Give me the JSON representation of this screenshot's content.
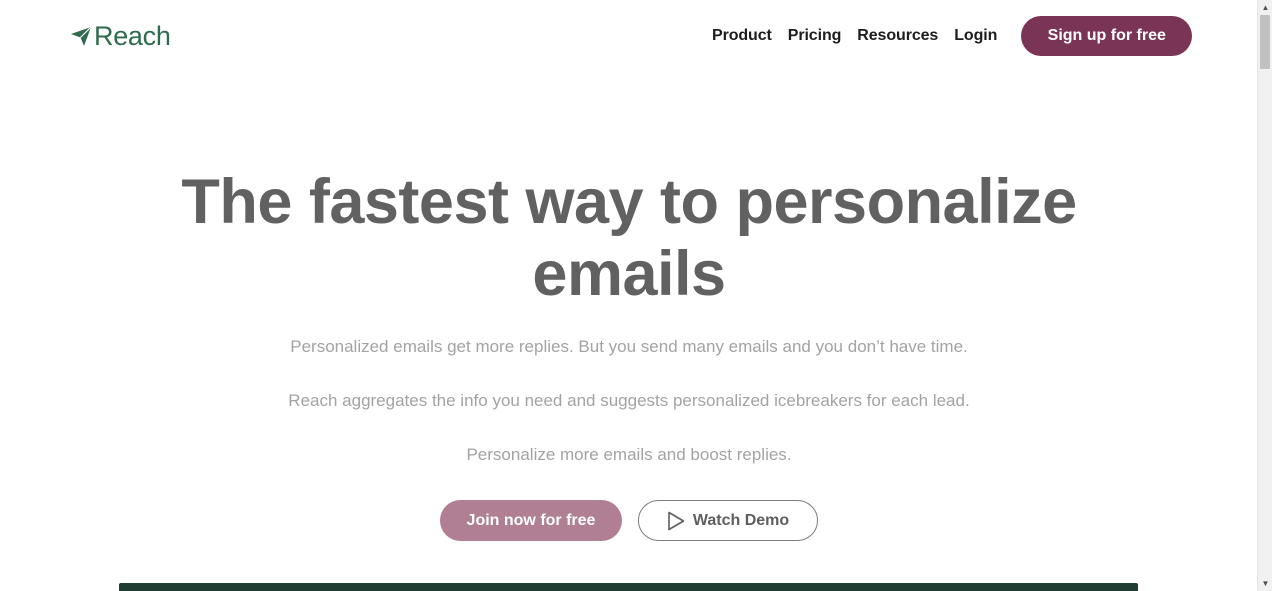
{
  "header": {
    "logo_text": "Reach",
    "logo_icon": "paper-plane-icon",
    "nav": [
      {
        "label": "Product"
      },
      {
        "label": "Pricing"
      },
      {
        "label": "Resources"
      },
      {
        "label": "Login"
      }
    ],
    "signup_label": "Sign up for free"
  },
  "hero": {
    "title_line1": "The fastest way to personalize",
    "title_line2": "emails",
    "paragraphs": [
      "Personalized emails get more replies. But you send many emails and you don’t have time.",
      "Reach aggregates the info you need and suggests personalized icebreakers for each lead.",
      "Personalize more emails and boost replies."
    ],
    "join_label": "Join now for free",
    "demo_label": "Watch Demo",
    "demo_icon": "play-icon"
  },
  "scrollbar": {
    "up_icon": "scroll-up-arrow-icon",
    "down_icon": "scroll-down-arrow-icon"
  },
  "colors": {
    "brand_green": "#2f6b4f",
    "brand_plum": "#7a3556",
    "join_button": "#b07f93",
    "band": "#1f3d33"
  }
}
